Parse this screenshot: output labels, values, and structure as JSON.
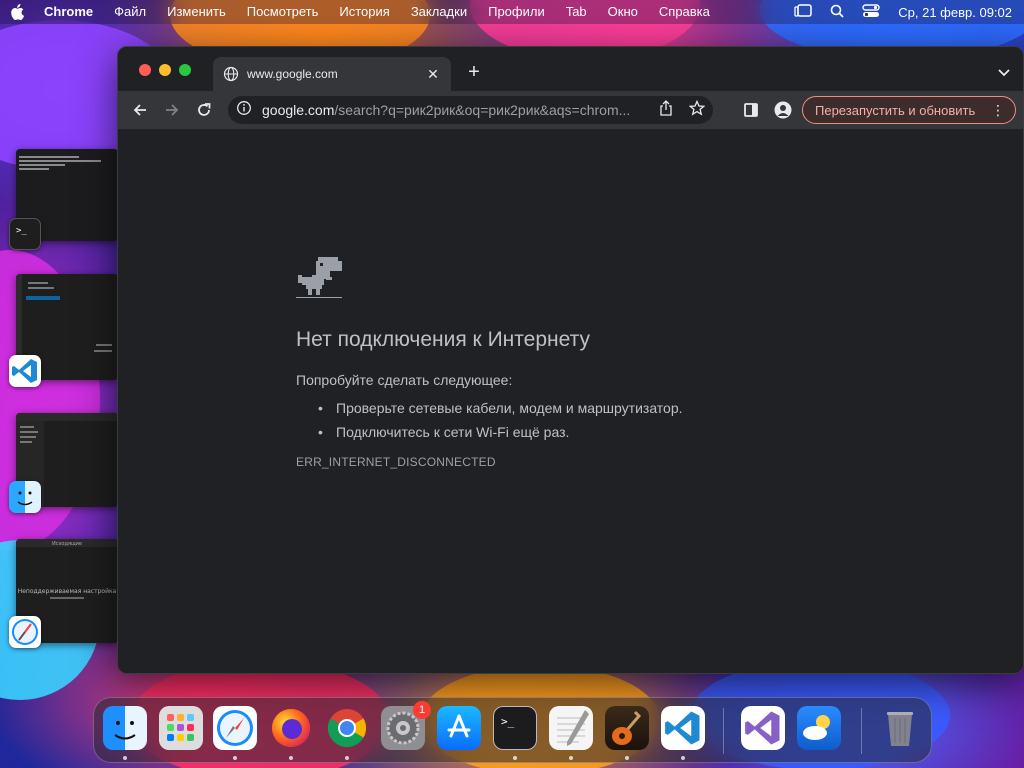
{
  "menubar": {
    "app_name": "Chrome",
    "items": [
      "Файл",
      "Изменить",
      "Посмотреть",
      "История",
      "Закладки",
      "Профили",
      "Tab",
      "Окно",
      "Справка"
    ],
    "clock": "Ср, 21 февр.  09:02"
  },
  "browser": {
    "tab": {
      "title": "www.google.com"
    },
    "omnibox": {
      "host": "google.com",
      "path": "/search?q=рик2рик&oq=рик2рик&aqs=chrom..."
    },
    "relaunch_label": "Перезапустить и обновить"
  },
  "error_page": {
    "title": "Нет подключения к Интернету",
    "try_label": "Попробуйте сделать следующее:",
    "suggestions": [
      "Проверьте сетевые кабели, модем и маршрутизатор.",
      "Подключитесь к сети Wi-Fi ещё раз."
    ],
    "error_code": "ERR_INTERNET_DISCONNECTED"
  },
  "stage_manager": {
    "thumb3_title": "Исходящие",
    "thumb4_text": "Неподдерживаемая настройка"
  },
  "dock": {
    "apps": [
      "finder",
      "launchpad",
      "safari",
      "firefox",
      "chrome",
      "system-settings",
      "app-store",
      "terminal",
      "textedit",
      "garageband",
      "vscode",
      "visual-studio",
      "weather",
      "trash"
    ],
    "settings_badge": "1"
  },
  "colors": {
    "window_bg": "#202124",
    "toolbar_bg": "#35363a",
    "relaunch_border": "#f28b82",
    "text_primary": "#bdc1c6"
  }
}
